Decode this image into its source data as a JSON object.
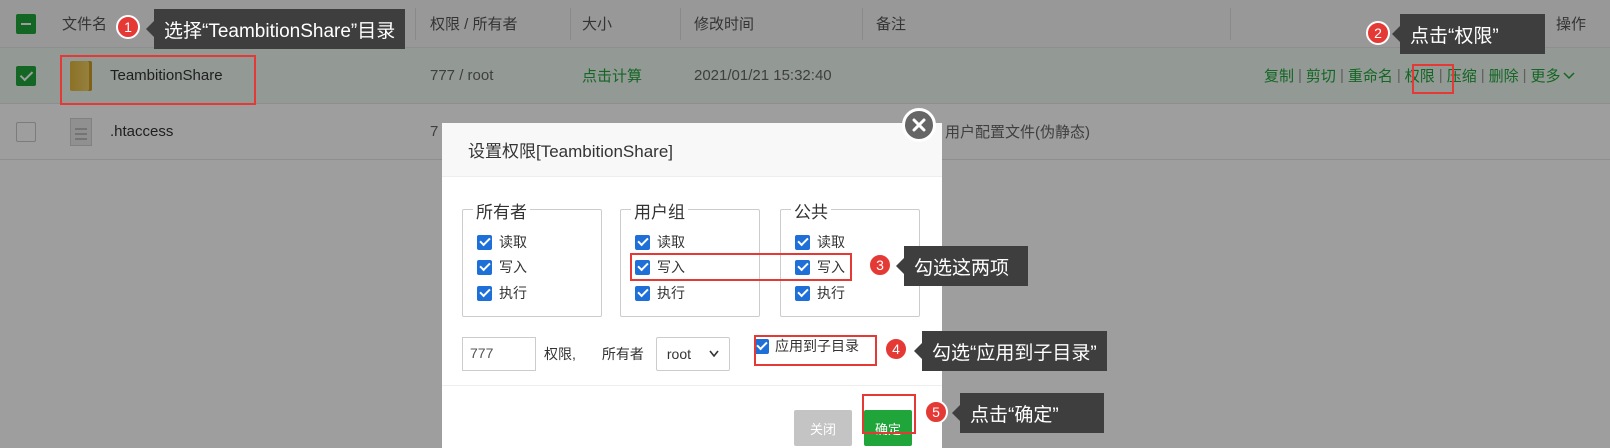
{
  "table": {
    "headers": {
      "filename": "文件名",
      "perm_owner": "权限 / 所有者",
      "size": "大小",
      "mtime": "修改时间",
      "note": "备注",
      "ops": "操作"
    },
    "rows": [
      {
        "name": "TeambitionShare",
        "perm": "777 / root",
        "size": "点击计算",
        "mtime": "2021/01/21 15:32:40",
        "note": "",
        "ops": [
          "复制",
          "剪切",
          "重命名",
          "权限",
          "压缩",
          "删除",
          "更多"
        ]
      },
      {
        "name": ".htaccess",
        "perm": "7",
        "note": "用户配置文件(伪静态)"
      }
    ]
  },
  "dialog": {
    "title": "设置权限[TeambitionShare]",
    "groups": [
      {
        "legend": "所有者",
        "options": [
          "读取",
          "写入",
          "执行"
        ]
      },
      {
        "legend": "用户组",
        "options": [
          "读取",
          "写入",
          "执行"
        ]
      },
      {
        "legend": "公共",
        "options": [
          "读取",
          "写入",
          "执行"
        ]
      }
    ],
    "perm_value": "777",
    "perm_label": "权限,",
    "owner_label": "所有者",
    "owner_value": "root",
    "apply_sub": "应用到子目录",
    "close_label": "关闭",
    "ok_label": "确定"
  },
  "annotations": [
    {
      "num": "1",
      "text": "选择“TeambitionShare”目录"
    },
    {
      "num": "2",
      "text": "点击“权限”"
    },
    {
      "num": "3",
      "text": "勾选这两项"
    },
    {
      "num": "4",
      "text": "勾选“应用到子目录”"
    },
    {
      "num": "5",
      "text": "点击“确定”"
    }
  ],
  "colors": {
    "brand_green": "#20a53a",
    "annotation_red": "#e53935",
    "checkbox_blue": "#1e6fd8"
  }
}
